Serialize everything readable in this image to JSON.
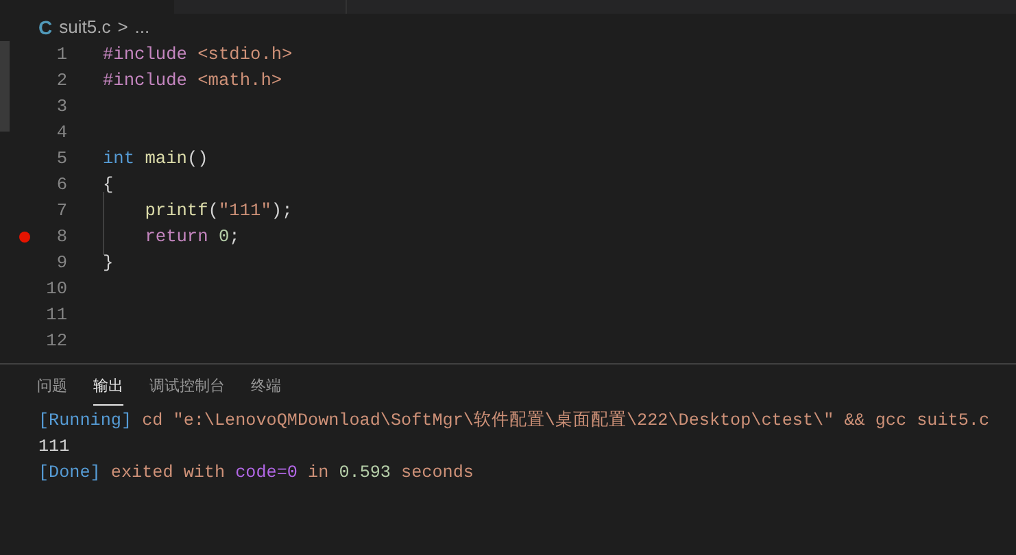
{
  "breadcrumb": {
    "file_icon": "C",
    "file": "suit5.c",
    "separator": ">",
    "more": "..."
  },
  "editor": {
    "lines": [
      {
        "number": "1",
        "breakpoint": false,
        "indent_guide": false,
        "tokens": [
          {
            "kind": "directive",
            "text": "#include"
          },
          {
            "kind": "string",
            "text": " <stdio.h>"
          }
        ]
      },
      {
        "number": "2",
        "breakpoint": false,
        "indent_guide": false,
        "tokens": [
          {
            "kind": "directive",
            "text": "#include"
          },
          {
            "kind": "string",
            "text": " <math.h>"
          }
        ]
      },
      {
        "number": "3",
        "breakpoint": false,
        "indent_guide": false
      },
      {
        "number": "4",
        "breakpoint": false,
        "indent_guide": false
      },
      {
        "number": "5",
        "breakpoint": false,
        "indent_guide": false,
        "tokens": [
          {
            "kind": "keyword",
            "text": "int"
          },
          {
            "kind": "function",
            "text": " main"
          },
          {
            "kind": "plain",
            "text": "()"
          }
        ]
      },
      {
        "number": "6",
        "breakpoint": false,
        "indent_guide": false,
        "tokens": [
          {
            "kind": "plain",
            "text": "{"
          }
        ]
      },
      {
        "number": "7",
        "breakpoint": false,
        "indent_guide": true,
        "tokens": [
          {
            "kind": "function",
            "text": "    printf"
          },
          {
            "kind": "plain",
            "text": "("
          },
          {
            "kind": "string",
            "text": "\"111\""
          },
          {
            "kind": "plain",
            "text": ");"
          }
        ]
      },
      {
        "number": "8",
        "breakpoint": true,
        "indent_guide": true,
        "tokens": [
          {
            "kind": "control",
            "text": "    return"
          },
          {
            "kind": "number",
            "text": " 0"
          },
          {
            "kind": "plain",
            "text": ";"
          }
        ]
      },
      {
        "number": "9",
        "breakpoint": false,
        "indent_guide": false,
        "tokens": [
          {
            "kind": "plain",
            "text": "}"
          }
        ]
      },
      {
        "number": "10",
        "breakpoint": false,
        "indent_guide": false
      },
      {
        "number": "11",
        "breakpoint": false,
        "indent_guide": false
      },
      {
        "number": "12",
        "breakpoint": false,
        "indent_guide": false
      }
    ]
  },
  "panel": {
    "tabs": [
      {
        "label": "问题",
        "selected": false
      },
      {
        "label": "输出",
        "selected": true
      },
      {
        "label": "调试控制台",
        "selected": false
      },
      {
        "label": "终端",
        "selected": false
      }
    ],
    "output": [
      [
        {
          "kind": "tag",
          "text": "[Running]"
        },
        {
          "kind": "text",
          "text": " cd \"e:\\LenovoQMDownload\\SoftMgr\\软件配置\\桌面配置\\222\\Desktop\\ctest\\\" && gcc suit5.c"
        }
      ],
      [
        {
          "kind": "plain",
          "text": "111"
        }
      ],
      [
        {
          "kind": "tag",
          "text": "[Done]"
        },
        {
          "kind": "text",
          "text": " exited with "
        },
        {
          "kind": "code",
          "text": "code=0"
        },
        {
          "kind": "text",
          "text": " in "
        },
        {
          "kind": "number",
          "text": "0.593"
        },
        {
          "kind": "text",
          "text": " seconds"
        }
      ]
    ]
  }
}
